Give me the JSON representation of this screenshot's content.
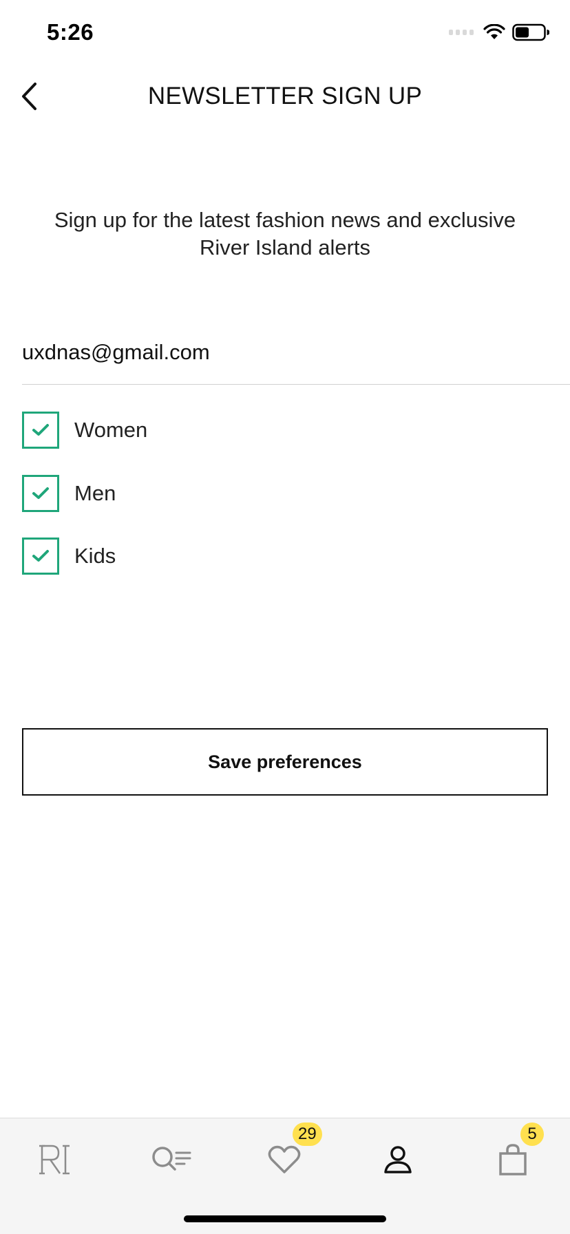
{
  "status_bar": {
    "time": "5:26",
    "icons": [
      "signal-icon",
      "wifi-icon",
      "battery-icon"
    ]
  },
  "header": {
    "back_icon": "chevron-left-icon",
    "title": "NEWSLETTER SIGN UP"
  },
  "intro": {
    "text": "Sign up for the latest fashion news and exclusive River Island alerts"
  },
  "form": {
    "email_value": "uxdnas@gmail.com",
    "preferences": [
      {
        "label": "Women",
        "checked": true
      },
      {
        "label": "Men",
        "checked": true
      },
      {
        "label": "Kids",
        "checked": true
      }
    ],
    "save_label": "Save preferences"
  },
  "tab_bar": {
    "items": [
      {
        "name": "home",
        "icon": "ri-logo-icon"
      },
      {
        "name": "search",
        "icon": "search-filter-icon"
      },
      {
        "name": "wishlist",
        "icon": "heart-icon",
        "badge": "29"
      },
      {
        "name": "account",
        "icon": "user-icon",
        "active": true
      },
      {
        "name": "bag",
        "icon": "bag-icon",
        "badge": "5"
      }
    ]
  },
  "colors": {
    "checkbox_accent": "#1fa67a",
    "badge": "#ffe04f",
    "tab_bar_bg": "#f5f5f5"
  }
}
